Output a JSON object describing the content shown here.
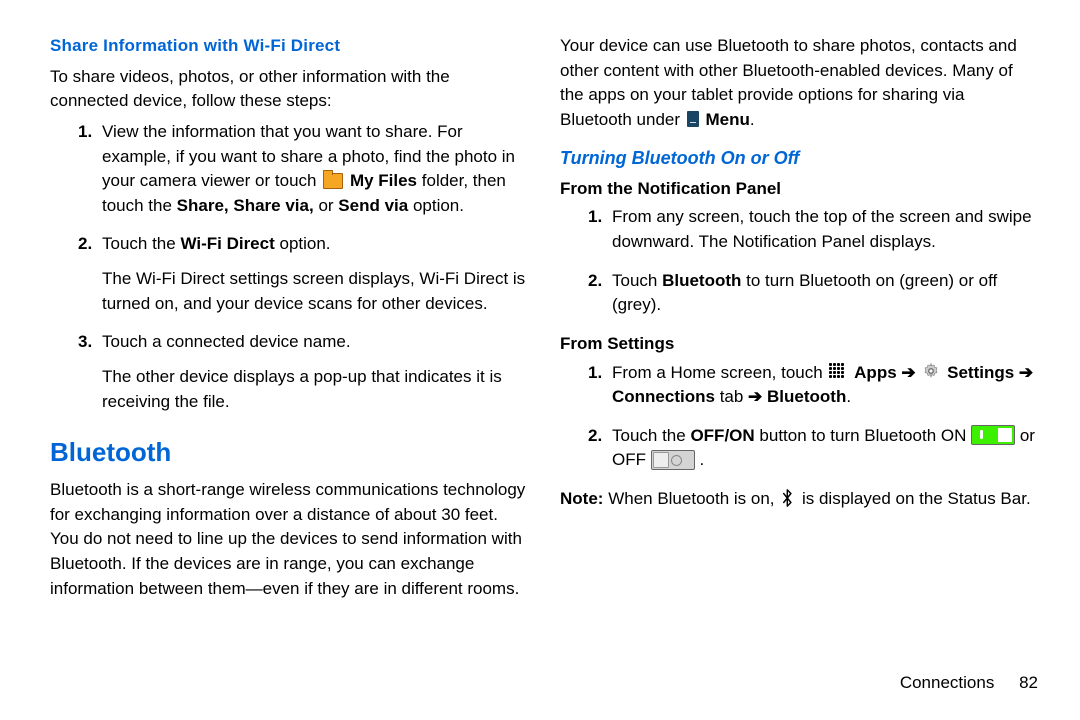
{
  "left": {
    "sub_heading": "Share Information with Wi-Fi Direct",
    "intro": "To share videos, photos, or other information with the connected device, follow these steps:",
    "steps": {
      "s1_a": "View the information that you want to share. For example, if you want to share a photo, find the photo in your camera viewer or touch ",
      "s1_bold_folder": "My Files",
      "s1_b": " folder, then touch the ",
      "s1_bold_share": "Share, Share via,",
      "s1_c": " or ",
      "s1_bold_sendvia": "Send via",
      "s1_d": " option.",
      "s2_a": "Touch the ",
      "s2_bold": "Wi-Fi Direct",
      "s2_b": " option.",
      "s2_p2": "The Wi-Fi Direct settings screen displays, Wi-Fi Direct is turned on, and your device scans for other devices.",
      "s3_a": "Touch a connected device name.",
      "s3_p2": "The other device displays a pop-up that indicates it is receiving the file."
    },
    "section_heading": "Bluetooth",
    "bt_intro": "Bluetooth is a short-range wireless communications technology for exchanging information over a distance of about 30 feet. You do not need to line up the devices to send information with Bluetooth. If the devices are in range, you can exchange information between them—even if they are in different rooms."
  },
  "right": {
    "top_a": "Your device can use Bluetooth to share photos, contacts and other content with other Bluetooth-enabled devices. Many of the apps on your tablet provide options for sharing via Bluetooth under ",
    "top_bold": "Menu",
    "top_b": ".",
    "heading": "Turning Bluetooth On or Off",
    "sub1": "From the Notification Panel",
    "np_s1": "From any screen, touch the top of the screen and swipe downward. The Notification Panel displays.",
    "np_s2_a": "Touch ",
    "np_s2_bold": "Bluetooth",
    "np_s2_b": " to turn Bluetooth on (green) or off (grey).",
    "sub2": "From Settings",
    "st_s1_a": "From a Home screen, touch ",
    "st_s1_apps": "Apps",
    "st_s1_settings": "Settings",
    "st_s1_conn": "Connections",
    "st_s1_tab": " tab ",
    "st_s1_bt": "Bluetooth",
    "st_s1_period": ".",
    "st_s2_a": "Touch the ",
    "st_s2_bold": "OFF/ON",
    "st_s2_b": " button to turn Bluetooth ON ",
    "st_s2_c": " or OFF ",
    "st_s2_d": ".",
    "note_label": "Note:",
    "note_a": " When Bluetooth is on, ",
    "note_b": " is displayed on the Status Bar."
  },
  "arrow": "➔",
  "footer": {
    "section": "Connections",
    "page": "82"
  }
}
